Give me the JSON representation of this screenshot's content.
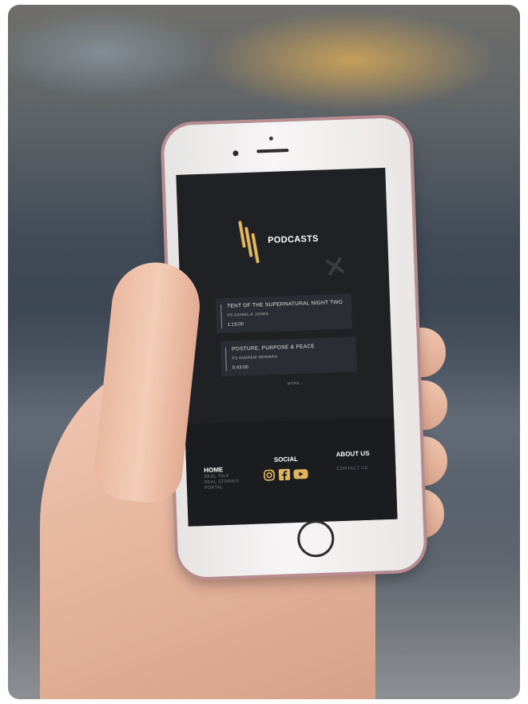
{
  "app": {
    "brand_label": "PODCASTS",
    "more_label": "MORE ›"
  },
  "episodes": [
    {
      "title": "TENT OF THE SUPERNATURAL NIGHT TWO",
      "author": "PS DANIEL K JONES",
      "duration": "1:19:00"
    },
    {
      "title": "POSTURE, PURPOSE & PEACE",
      "author": "PS ANDREW NEWMAN",
      "duration": "0:43:00"
    }
  ],
  "footer": {
    "home_label": "HOME",
    "links": [
      "REAL TALK",
      "REAL STORIES",
      "PORTAL"
    ],
    "social_label": "SOCIAL",
    "social_icons": [
      "instagram-icon",
      "facebook-icon",
      "youtube-icon"
    ],
    "about_label": "ABOUT US",
    "contact_label": "CONTACT US"
  },
  "colors": {
    "accent": "#e2b45c",
    "screen_bg": "#1f2125",
    "card_bg": "#2a2d33",
    "footer_bg": "#1b1c20"
  }
}
